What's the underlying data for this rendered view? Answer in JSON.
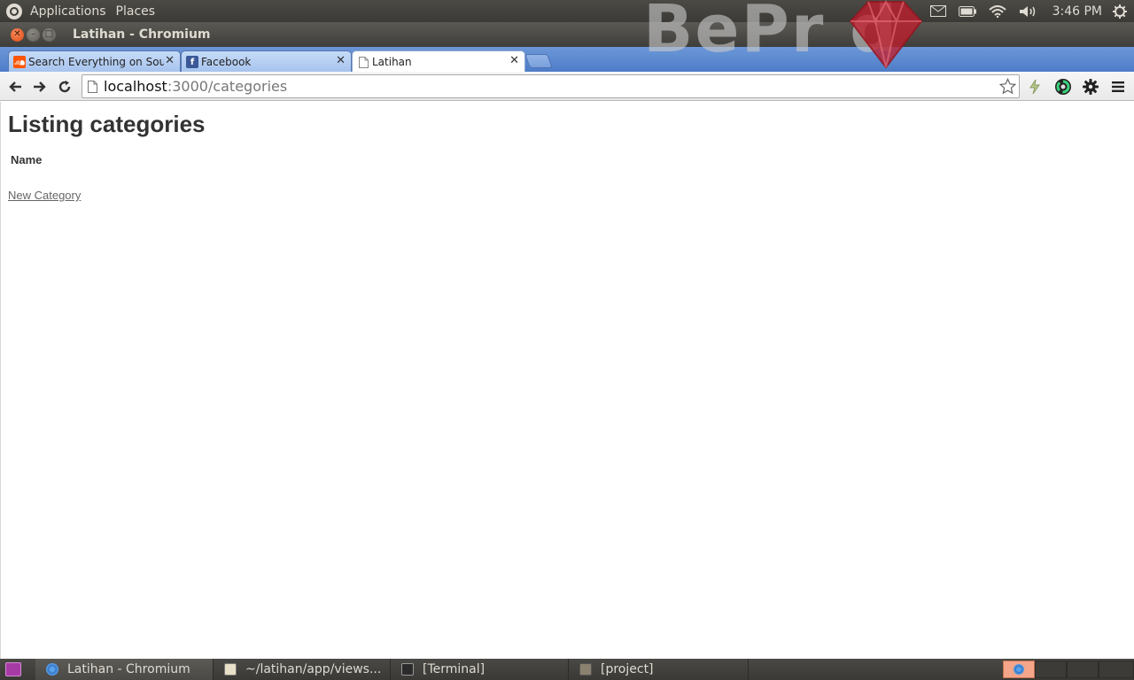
{
  "top_panel": {
    "menus": [
      "Applications",
      "Places"
    ],
    "clock": "3:46 PM",
    "icons": [
      "mail-icon",
      "battery-icon",
      "wifi-icon",
      "volume-icon",
      "power-icon"
    ]
  },
  "watermark": {
    "text": "BePr d"
  },
  "window": {
    "title": "Latihan - Chromium"
  },
  "tabs": [
    {
      "label": "Search Everything on Sou",
      "favicon": "soundcloud-icon",
      "color": "#ff5500"
    },
    {
      "label": "Facebook",
      "favicon": "facebook-icon",
      "color": "#3b5998"
    },
    {
      "label": "Latihan",
      "favicon": "page-icon",
      "active": true
    }
  ],
  "toolbar": {
    "url_host": "localhost",
    "url_rest": ":3000/categories"
  },
  "page": {
    "title": "Listing categories",
    "table_headers": [
      "Name"
    ],
    "new_link": "New Category"
  },
  "taskbar": {
    "tasks": [
      {
        "label": "Latihan - Chromium",
        "icon": "chromium-icon",
        "active": true
      },
      {
        "label": "~/latihan/app/views...",
        "icon": "text-editor-icon"
      },
      {
        "label": "[Terminal]",
        "icon": "terminal-icon"
      },
      {
        "label": "[project]",
        "icon": "file-manager-icon"
      }
    ]
  },
  "colors": {
    "tabstrip": "#5b88d0",
    "title_text": "#333333",
    "link": "#666666",
    "close_button": "#e5541f"
  }
}
